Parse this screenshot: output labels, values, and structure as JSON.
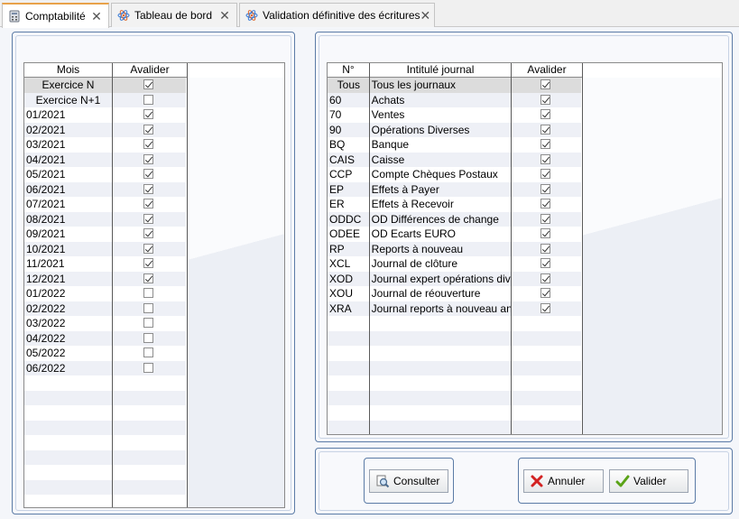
{
  "tabs": [
    {
      "label": "Comptabilité",
      "icon": "calculator-icon",
      "active": true
    },
    {
      "label": "Tableau de bord",
      "icon": "atom-icon",
      "active": false
    },
    {
      "label": "Validation définitive des écritures",
      "icon": "atom-icon",
      "active": false
    }
  ],
  "months_grid": {
    "headers": {
      "mois": "Mois",
      "avalider": "Avalider"
    },
    "rows": [
      {
        "mois": "Exercice N",
        "checked": true,
        "selected": true,
        "centered": true
      },
      {
        "mois": "Exercice N+1",
        "checked": false,
        "centered": true
      },
      {
        "mois": "01/2021",
        "checked": true
      },
      {
        "mois": "02/2021",
        "checked": true
      },
      {
        "mois": "03/2021",
        "checked": true
      },
      {
        "mois": "04/2021",
        "checked": true
      },
      {
        "mois": "05/2021",
        "checked": true
      },
      {
        "mois": "06/2021",
        "checked": true
      },
      {
        "mois": "07/2021",
        "checked": true
      },
      {
        "mois": "08/2021",
        "checked": true
      },
      {
        "mois": "09/2021",
        "checked": true
      },
      {
        "mois": "10/2021",
        "checked": true
      },
      {
        "mois": "11/2021",
        "checked": true
      },
      {
        "mois": "12/2021",
        "checked": true
      },
      {
        "mois": "01/2022",
        "checked": false
      },
      {
        "mois": "02/2022",
        "checked": false
      },
      {
        "mois": "03/2022",
        "checked": false
      },
      {
        "mois": "04/2022",
        "checked": false
      },
      {
        "mois": "05/2022",
        "checked": false
      },
      {
        "mois": "06/2022",
        "checked": false
      }
    ],
    "total_rows": 28
  },
  "journals_grid": {
    "headers": {
      "num": "N°",
      "intitule": "Intitulé journal",
      "avalider": "Avalider"
    },
    "rows": [
      {
        "num": "Tous",
        "intitule": "Tous les journaux",
        "checked": true,
        "selected": true,
        "centered": true
      },
      {
        "num": "60",
        "intitule": "Achats",
        "checked": true
      },
      {
        "num": "70",
        "intitule": "Ventes",
        "checked": true
      },
      {
        "num": "90",
        "intitule": "Opérations Diverses",
        "checked": true
      },
      {
        "num": "BQ",
        "intitule": "Banque",
        "checked": true
      },
      {
        "num": "CAIS",
        "intitule": "Caisse",
        "checked": true
      },
      {
        "num": "CCP",
        "intitule": "Compte Chèques Postaux",
        "checked": true
      },
      {
        "num": "EP",
        "intitule": "Effets à Payer",
        "checked": true
      },
      {
        "num": "ER",
        "intitule": "Effets à Recevoir",
        "checked": true
      },
      {
        "num": "ODDC",
        "intitule": "OD Différences de change",
        "checked": true
      },
      {
        "num": "ODEE",
        "intitule": "OD Ecarts EURO",
        "checked": true
      },
      {
        "num": "RP",
        "intitule": "Reports à nouveau",
        "checked": true
      },
      {
        "num": "XCL",
        "intitule": "Journal de clôture",
        "checked": true
      },
      {
        "num": "XOD",
        "intitule": "Journal expert opérations div",
        "checked": true
      },
      {
        "num": "XOU",
        "intitule": "Journal de réouverture",
        "checked": true
      },
      {
        "num": "XRA",
        "intitule": "Journal reports à nouveau an",
        "checked": true
      }
    ],
    "total_rows": 24
  },
  "buttons": {
    "consulter": "Consulter",
    "annuler": "Annuler",
    "valider": "Valider"
  }
}
